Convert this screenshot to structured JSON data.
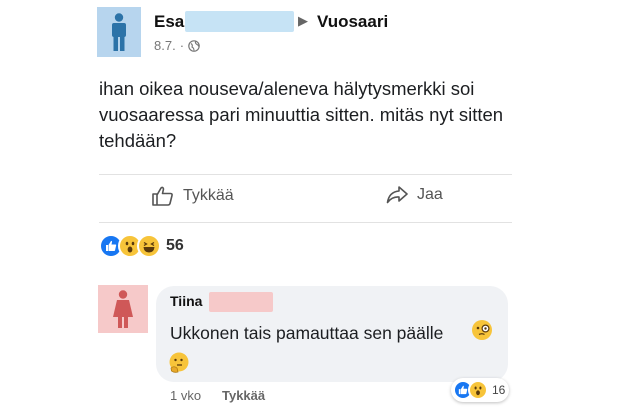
{
  "post": {
    "author_first": "Esa",
    "place": "Vuosaari",
    "date": "8.7.",
    "separator": "·",
    "text": "ihan oikea nouseva/aleneva hälytysmerkki soi vuosaaressa pari minuuttia sitten. mitäs nyt sitten tehdään?"
  },
  "actions": {
    "like_label": "Tykkää",
    "share_label": "Jaa"
  },
  "reactions": {
    "icons": [
      "like-icon",
      "wow-emoji",
      "haha-emoji"
    ],
    "count": "56"
  },
  "comment": {
    "author_first": "Tiina",
    "text": "Ukkonen tais pamauttaa sen päälle",
    "time": "1 vko",
    "like_label": "Tykkää",
    "reactions": {
      "icons": [
        "like-icon",
        "wow-emoji"
      ],
      "count": "16"
    }
  },
  "colors": {
    "male_avatar_bg": "#b7d5ee",
    "female_avatar_bg": "#f6c9c9",
    "like_blue": "#1877f2",
    "emoji_yellow": "#f7c43a",
    "bubble_bg": "#f0f2f5"
  }
}
